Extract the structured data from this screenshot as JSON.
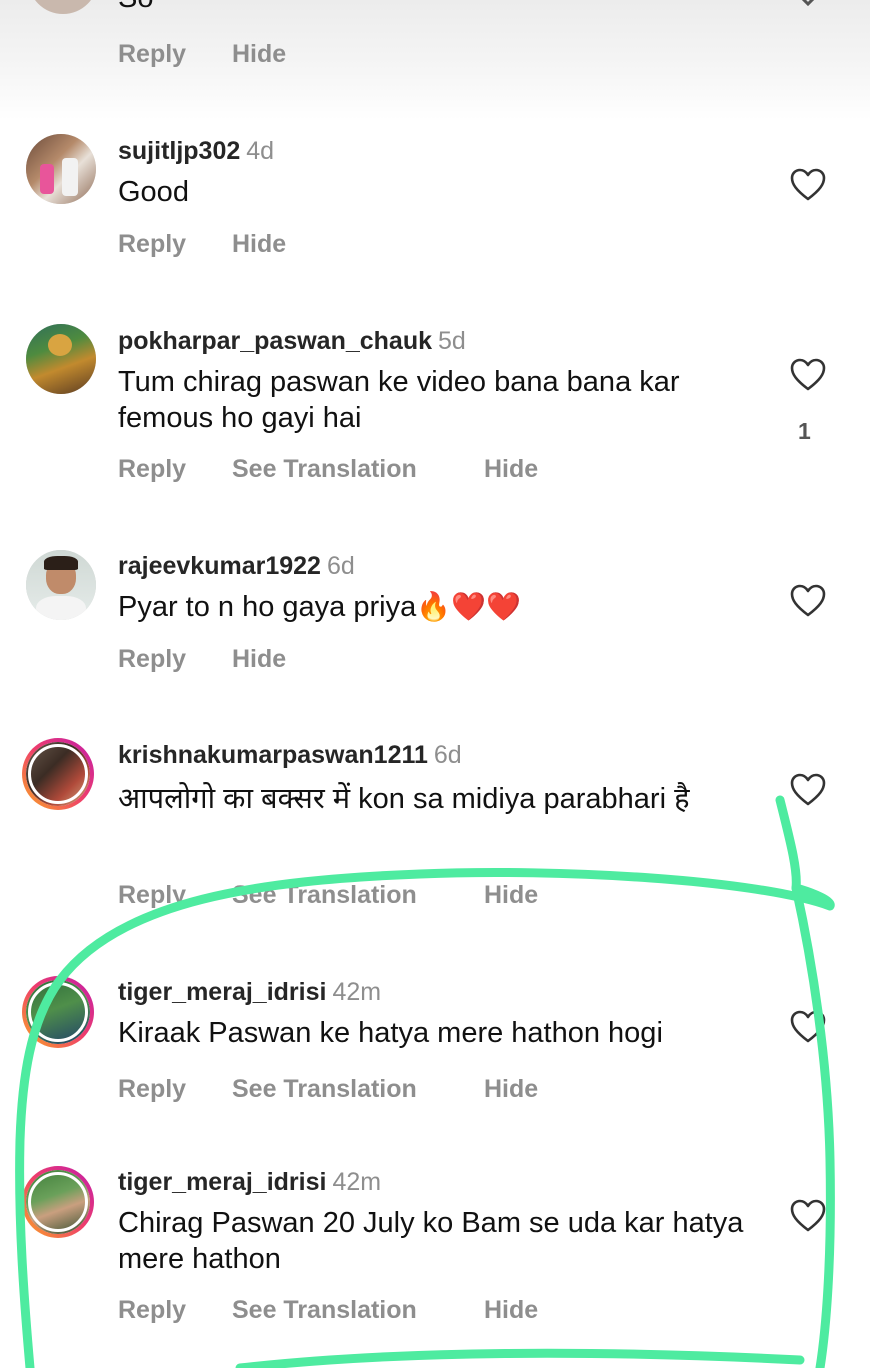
{
  "actions": {
    "reply": "Reply",
    "hide": "Hide",
    "see_translation": "See Translation"
  },
  "partial_comment": {
    "text": "So"
  },
  "comments": [
    {
      "username": "sujitljp302",
      "time": "4d",
      "text": "Good",
      "likes": null,
      "translation": false
    },
    {
      "username": "pokharpar_paswan_chauk",
      "time": "5d",
      "text": "Tum chirag paswan ke video bana bana kar femous ho gayi hai",
      "likes": "1",
      "translation": true
    },
    {
      "username": "rajeevkumar1922",
      "time": "6d",
      "text": "Pyar to n ho gaya priya",
      "emojis": [
        "🔥",
        "❤️",
        "❤️"
      ],
      "likes": null,
      "translation": false
    },
    {
      "username": "krishnakumarpaswan1211",
      "time": "6d",
      "text": "आपलोगो का बक्सर में kon sa midiya parabhari है",
      "likes": null,
      "translation": true
    },
    {
      "username": "tiger_meraj_idrisi",
      "time": "42m",
      "text": "Kiraak Paswan ke hatya mere hathon hogi",
      "likes": null,
      "translation": true
    },
    {
      "username": "tiger_meraj_idrisi",
      "time": "42m",
      "text": "Chirag Paswan 20 July ko Bam se uda kar hatya mere hathon",
      "likes": null,
      "translation": true
    }
  ],
  "colors": {
    "username": "#262626",
    "secondary_text": "#8e8e8e",
    "highlight_marker": "#4eeba0"
  },
  "icons": {
    "like": "heart-outline-icon",
    "collapse": "chevron-down-icon"
  }
}
